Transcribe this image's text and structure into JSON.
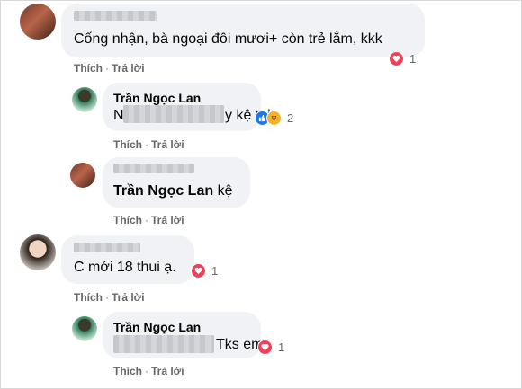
{
  "comments": [
    {
      "text": "Cống nhận, bà ngoại đôi mươi+ còn trẻ lắm, kkk",
      "actions": {
        "like": "Thích",
        "reply": "Trả lời"
      },
      "reaction_count": "1",
      "reactions": [
        "heart-icon"
      ],
      "replies": [
        {
          "author": "Trần Ngọc Lan",
          "text_prefix": "N",
          "text_suffix": "y kệ tui",
          "actions": {
            "like": "Thích",
            "reply": "Trả lời"
          },
          "reaction_count": "2",
          "reactions": [
            "like-icon",
            "haha-icon"
          ]
        },
        {
          "mention": "Trần Ngọc Lan",
          "text": "kệ",
          "actions": {
            "like": "Thích",
            "reply": "Trả lời"
          }
        }
      ]
    },
    {
      "text": "C mới 18 thui ạ.",
      "actions": {
        "like": "Thích",
        "reply": "Trả lời"
      },
      "reaction_count": "1",
      "reactions": [
        "heart-icon"
      ],
      "replies": [
        {
          "author": "Trần Ngọc Lan",
          "text": "Tks em",
          "actions": {
            "like": "Thích",
            "reply": "Trả lời"
          },
          "reaction_count": "1",
          "reactions": [
            "heart-icon"
          ]
        }
      ]
    }
  ],
  "colors": {
    "bubble": "#f0f2f5",
    "secondary_text": "#65676b",
    "heart": "#f33e58",
    "like": "#1877f2",
    "haha": "#f7b125"
  }
}
